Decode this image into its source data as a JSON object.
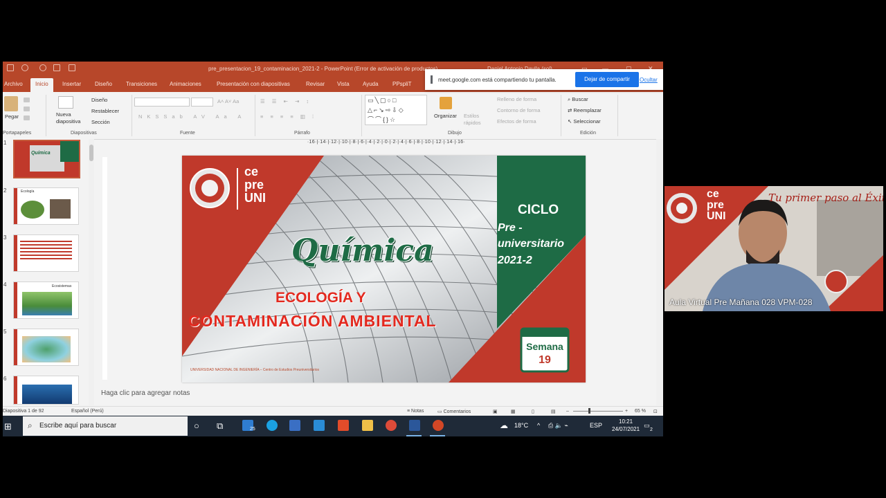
{
  "window": {
    "title": "pre_presentacion_19_contaminacion_2021-2 - PowerPoint (Error de activación de productos)",
    "user": "Daniel Antonio Davila (sol)"
  },
  "tabs": [
    "Archivo",
    "Inicio",
    "Insertar",
    "Diseño",
    "Transiciones",
    "Animaciones",
    "Presentación con diapositivas",
    "Revisar",
    "Vista",
    "Ayuda",
    "PPspliT"
  ],
  "share_banner": {
    "text": "meet.google.com está compartiendo tu pantalla.",
    "stop_button": "Dejar de compartir",
    "hide_link": "Ocultar"
  },
  "ribbon": {
    "portapapeles": {
      "pegar": "Pegar",
      "label": "Portapapeles"
    },
    "diapositivas": {
      "nueva": "Nueva diapositiva",
      "diseno": "Diseño",
      "restablecer": "Restablecer",
      "seccion": "Sección",
      "label": "Diapositivas"
    },
    "fuente": {
      "label": "Fuente"
    },
    "parrafo": {
      "label": "Párrafo"
    },
    "dibujo": {
      "organizar": "Organizar",
      "estilos": "Estilos rápidos",
      "relleno": "Relleno de forma",
      "contorno": "Contorno de forma",
      "efectos": "Efectos de forma",
      "label": "Dibujo"
    },
    "edicion": {
      "buscar": "Buscar",
      "reemplazar": "Reemplazar",
      "seleccionar": "Seleccionar",
      "label": "Edición"
    }
  },
  "thumbnails": [
    {
      "num": "1",
      "title": "Química"
    },
    {
      "num": "2",
      "title": "Ecología"
    },
    {
      "num": "3",
      "title": ""
    },
    {
      "num": "4",
      "title": "Ecosistemas"
    },
    {
      "num": "5",
      "title": ""
    },
    {
      "num": "6",
      "title": ""
    }
  ],
  "ruler": "·16·|·14·|·12·|·10·|·8·|·6·|·4·|·2·|·0·|·2·|·4·|·6·|·8·|·10·|·12·|·14·|·16·",
  "slide": {
    "logo": [
      "ce",
      "pre",
      "UNI"
    ],
    "title": "Química",
    "subtitle1": "ECOLOGÍA Y",
    "subtitle2": "CONTAMINACIÓN AMBIENTAL",
    "ciclo": "CICLO",
    "pre": "Pre -",
    "universitario": "universitario",
    "year": "2021-2",
    "semana": "Semana",
    "semana_num": "19",
    "footer": "UNIVERSIDAD NACIONAL DE INGENIERÍA – Centro de Estudios Preuniversitarios"
  },
  "notes_placeholder": "Haga clic para agregar notas",
  "status": {
    "slide": "Diapositiva 1 de 92",
    "lang": "Español (Perú)",
    "notas": "Notas",
    "comentarios": "Comentarios",
    "zoom": "65 %"
  },
  "taskbar": {
    "search": "Escribe aquí para buscar",
    "mail_badge": "25",
    "temp": "18°C",
    "lang": "ESP",
    "time": "10:21",
    "date": "24/07/2021",
    "notif": "2"
  },
  "webcam": {
    "label": "Aula Virtual Pre Mañana 028 VPM-028",
    "banner": "Tu primer paso al Éxito",
    "logo": [
      "ce",
      "pre",
      "UNI"
    ]
  },
  "colors": {
    "ppt_red": "#b7472a",
    "slide_red": "#c0392b",
    "slide_green": "#1e6b45",
    "share_blue": "#1a73e8"
  }
}
